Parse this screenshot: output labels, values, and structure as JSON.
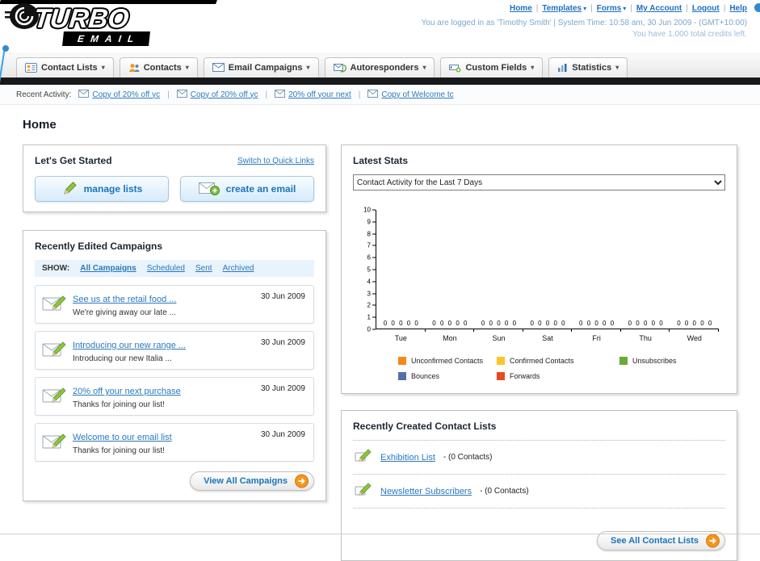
{
  "header": {
    "logo_title": "TURBO",
    "logo_subtitle": "EMAIL",
    "nav_links": [
      {
        "label": "Home",
        "dropdown": false
      },
      {
        "label": "Templates",
        "dropdown": true
      },
      {
        "label": "Forms",
        "dropdown": true
      },
      {
        "label": "My Account",
        "dropdown": false
      },
      {
        "label": "Logout",
        "dropdown": false
      },
      {
        "label": "Help",
        "dropdown": false
      }
    ],
    "login_info": "You are logged in as 'Timothy Smith' | System Time: 10:58 am, 30 Jun 2009 - (GMT+10:00)",
    "credits_info": "You have 1,000 total credits left."
  },
  "nav_tabs": [
    {
      "label": "Contact Lists",
      "icon": "contact-lists-icon"
    },
    {
      "label": "Contacts",
      "icon": "contacts-icon"
    },
    {
      "label": "Email Campaigns",
      "icon": "email-campaigns-icon"
    },
    {
      "label": "Autoresponders",
      "icon": "autoresponders-icon"
    },
    {
      "label": "Custom Fields",
      "icon": "custom-fields-icon"
    },
    {
      "label": "Statistics",
      "icon": "statistics-icon"
    }
  ],
  "recent_activity": {
    "label": "Recent Activity:",
    "items": [
      "Copy of 20% off yc",
      "Copy of 20% off yc",
      "20% off your next",
      "Copy of Welcome tc"
    ]
  },
  "page_title": "Home",
  "get_started": {
    "title": "Let's Get Started",
    "switch_link": "Switch to Quick Links",
    "buttons": [
      {
        "label": "manage lists"
      },
      {
        "label": "create an email"
      }
    ]
  },
  "campaigns": {
    "title": "Recently Edited Campaigns",
    "show_label": "SHOW:",
    "filters": [
      "All Campaigns",
      "Scheduled",
      "Sent",
      "Archived"
    ],
    "items": [
      {
        "title": "See us at the retail food ...",
        "subtitle": "We're giving away our late ...",
        "date": "30 Jun 2009"
      },
      {
        "title": "Introducing our new range ...",
        "subtitle": "Introducing our new Italia ...",
        "date": "30 Jun 2009"
      },
      {
        "title": "20% off your next purchase",
        "subtitle": "Thanks for joining our list!",
        "date": "30 Jun 2009"
      },
      {
        "title": "Welcome to our email list",
        "subtitle": "Thanks for joining our list!",
        "date": "30 Jun 2009"
      }
    ],
    "view_all_label": "View All Campaigns"
  },
  "stats": {
    "title": "Latest Stats",
    "filter_value": "Contact Activity for the Last 7 Days",
    "legend": [
      {
        "label": "Unconfirmed Contacts",
        "color": "#f6871f"
      },
      {
        "label": "Confirmed Contacts",
        "color": "#fdc52d"
      },
      {
        "label": "Unsubscribes",
        "color": "#6aaa35"
      },
      {
        "label": "Bounces",
        "color": "#5470a8"
      },
      {
        "label": "Forwards",
        "color": "#e84b22"
      }
    ]
  },
  "chart_data": {
    "type": "bar",
    "title": "Contact Activity for the Last 7 Days",
    "categories": [
      "Tue",
      "Mon",
      "Sun",
      "Sat",
      "Fri",
      "Thu",
      "Wed"
    ],
    "series": [
      {
        "name": "Unconfirmed Contacts",
        "color": "#f6871f",
        "values": [
          0,
          0,
          0,
          0,
          0,
          0,
          0
        ]
      },
      {
        "name": "Confirmed Contacts",
        "color": "#fdc52d",
        "values": [
          0,
          0,
          0,
          0,
          0,
          0,
          0
        ]
      },
      {
        "name": "Unsubscribes",
        "color": "#6aaa35",
        "values": [
          0,
          0,
          0,
          0,
          0,
          0,
          0
        ]
      },
      {
        "name": "Bounces",
        "color": "#5470a8",
        "values": [
          0,
          0,
          0,
          0,
          0,
          0,
          0
        ]
      },
      {
        "name": "Forwards",
        "color": "#e84b22",
        "values": [
          0,
          0,
          0,
          0,
          0,
          0,
          0
        ]
      }
    ],
    "ylim": [
      0,
      10
    ],
    "yticks": [
      0,
      1,
      2,
      3,
      4,
      5,
      6,
      7,
      8,
      9,
      10
    ],
    "xlabel": "",
    "ylabel": "",
    "grid": false,
    "legend_position": "bottom"
  },
  "contact_lists": {
    "title": "Recently Created Contact Lists",
    "items": [
      {
        "name": "Exhibition List",
        "suffix": "- (0 Contacts)"
      },
      {
        "name": "Newsletter Subscribers",
        "suffix": "- (0 Contacts)"
      }
    ],
    "see_all_label": "See All Contact Lists"
  }
}
